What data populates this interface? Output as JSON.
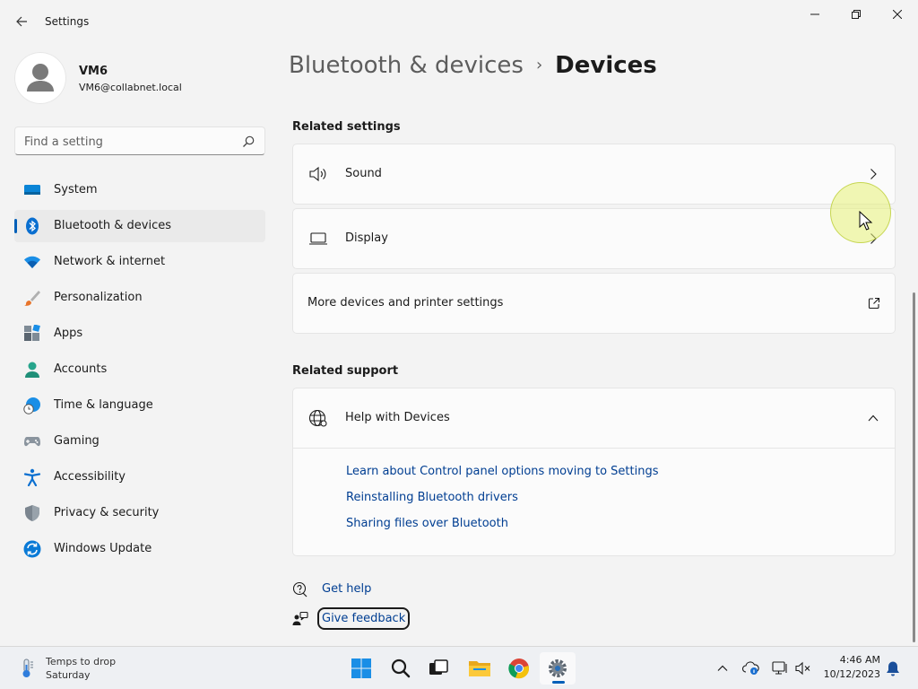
{
  "window": {
    "title": "Settings"
  },
  "user": {
    "name": "VM6",
    "email": "VM6@collabnet.local"
  },
  "search": {
    "placeholder": "Find a setting"
  },
  "sidebar": {
    "items": [
      {
        "label": "System",
        "icon": "system-icon"
      },
      {
        "label": "Bluetooth & devices",
        "icon": "bluetooth-icon",
        "active": true
      },
      {
        "label": "Network & internet",
        "icon": "wifi-icon"
      },
      {
        "label": "Personalization",
        "icon": "brush-icon"
      },
      {
        "label": "Apps",
        "icon": "apps-icon"
      },
      {
        "label": "Accounts",
        "icon": "accounts-icon"
      },
      {
        "label": "Time & language",
        "icon": "globe-clock-icon"
      },
      {
        "label": "Gaming",
        "icon": "gamepad-icon"
      },
      {
        "label": "Accessibility",
        "icon": "accessibility-icon"
      },
      {
        "label": "Privacy & security",
        "icon": "shield-icon"
      },
      {
        "label": "Windows Update",
        "icon": "update-icon"
      }
    ]
  },
  "breadcrumb": {
    "parent": "Bluetooth & devices",
    "separator": "›",
    "current": "Devices"
  },
  "related_settings": {
    "title": "Related settings",
    "items": [
      {
        "label": "Sound",
        "icon": "speaker-icon"
      },
      {
        "label": "Display",
        "icon": "monitor-icon"
      },
      {
        "label": "More devices and printer settings",
        "icon": "external-link-icon"
      }
    ]
  },
  "related_support": {
    "title": "Related support",
    "header": "Help with Devices",
    "links": [
      "Learn about Control panel options moving to Settings",
      "Reinstalling Bluetooth drivers",
      "Sharing files over Bluetooth"
    ]
  },
  "footer_links": {
    "get_help": "Get help",
    "give_feedback": "Give feedback"
  },
  "taskbar": {
    "weather_title": "Temps to drop",
    "weather_subtitle": "Saturday",
    "time": "4:46 AM",
    "date": "10/12/2023"
  },
  "colors": {
    "accent": "#005fb8",
    "link": "#003e92",
    "background": "#f3f3f3",
    "card": "#fbfbfb"
  }
}
